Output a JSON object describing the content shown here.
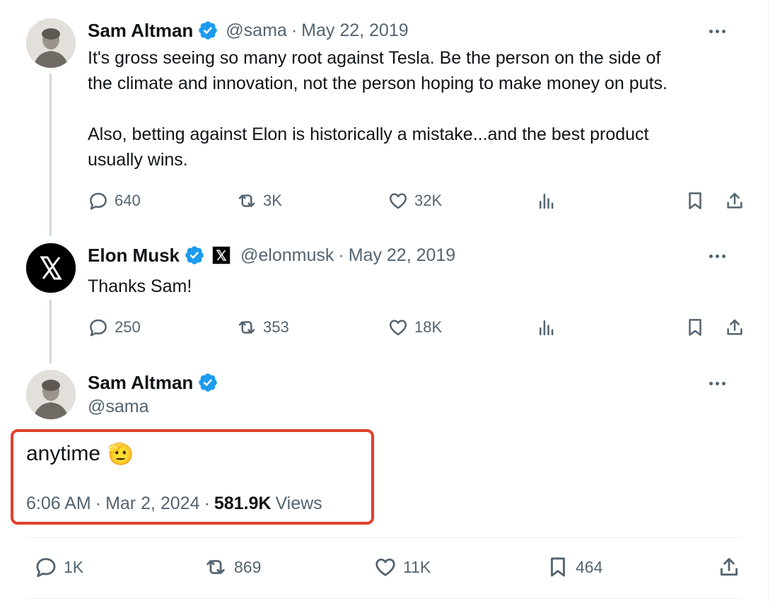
{
  "tweets": [
    {
      "author": "Sam Altman",
      "handle": "@sama",
      "date": "May 22, 2019",
      "text_lines": [
        "It's gross seeing so many root against Tesla. Be the person on the side of",
        "the climate and innovation, not the person hoping to make money on puts.",
        "",
        "Also, betting against Elon is historically a mistake...and the best product",
        "usually wins."
      ],
      "replies": "640",
      "retweets": "3K",
      "likes": "32K"
    },
    {
      "author": "Elon Musk",
      "handle": "@elonmusk",
      "date": "May 22, 2019",
      "text": "Thanks Sam!",
      "replies": "250",
      "retweets": "353",
      "likes": "18K"
    }
  ],
  "main_tweet": {
    "author": "Sam Altman",
    "handle": "@sama",
    "text": "anytime",
    "emoji": "🫡",
    "time": "6:06 AM",
    "date": "Mar 2, 2024",
    "views_count": "581.9K",
    "views_label": "Views",
    "replies": "1K",
    "retweets": "869",
    "likes": "11K",
    "bookmarks": "464"
  },
  "colors": {
    "verified": "#1d9bf0",
    "highlight": "#e0412a",
    "muted": "#536471"
  },
  "icons": [
    "reply-icon",
    "retweet-icon",
    "like-icon",
    "views-icon",
    "bookmark-icon",
    "share-icon",
    "verified-badge-icon",
    "x-affiliate-icon",
    "more-icon"
  ]
}
